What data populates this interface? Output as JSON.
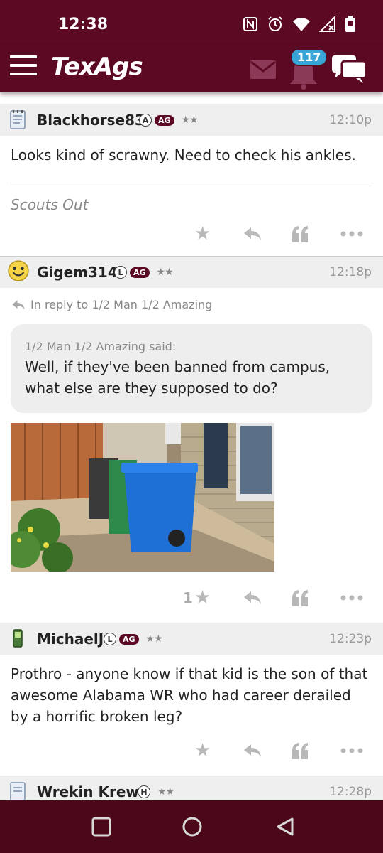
{
  "status": {
    "time": "12:38"
  },
  "app": {
    "brand": "TexAgs",
    "notifications_count": "117"
  },
  "posts": [
    {
      "username": "Blackhorse83",
      "badge_letter": "A",
      "badge_ag": "AG",
      "stars": "★★",
      "time": "12:10p",
      "text": "Looks kind of scrawny. Need to check his ankles.",
      "signature": "Scouts Out",
      "likes": ""
    },
    {
      "username": "Gigem314",
      "badge_letter": "L",
      "badge_ag": "AG",
      "stars": "★★",
      "time": "12:18p",
      "reply_to": "In reply to 1/2 Man 1/2 Amazing",
      "quote_label": "1/2 Man 1/2 Amazing said:",
      "quote_text": "Well, if they've been banned from campus, what else are they supposed to do?",
      "likes": "1"
    },
    {
      "username": "MichaelJ",
      "badge_letter": "L",
      "badge_ag": "AG",
      "stars": "★★",
      "time": "12:23p",
      "text": "Prothro - anyone know if that kid is the son of that awesome Alabama WR who had career derailed by a horrific broken leg?",
      "likes": ""
    },
    {
      "username": "Wrekin Krew",
      "badge_letter": "H",
      "stars": "★★",
      "time": "12:28p"
    }
  ],
  "colors": {
    "brand": "#5c0a24",
    "badge_blue": "#3aa6d8"
  }
}
